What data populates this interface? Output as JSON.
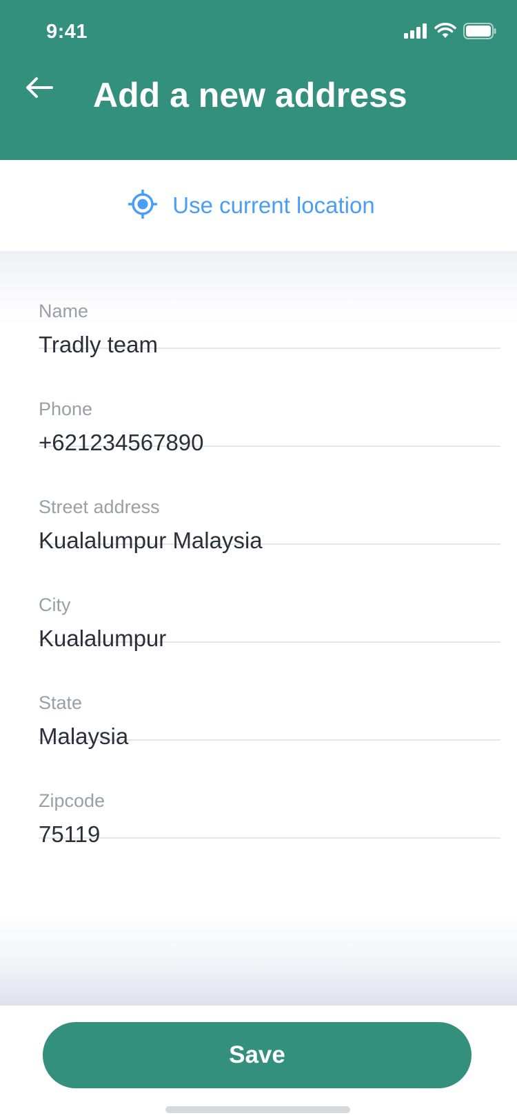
{
  "status_bar": {
    "time": "9:41",
    "icons": [
      "cellular-signal-icon",
      "wifi-icon",
      "battery-icon"
    ]
  },
  "header": {
    "title": "Add a new address",
    "back_icon": "arrow-left-icon"
  },
  "location": {
    "label": "Use current location",
    "icon": "crosshair-location-icon"
  },
  "form": {
    "fields": [
      {
        "label": "Name",
        "value": "Tradly team"
      },
      {
        "label": "Phone",
        "value": "+621234567890"
      },
      {
        "label": "Street address",
        "value": "Kualalumpur Malaysia"
      },
      {
        "label": "City",
        "value": "Kualalumpur"
      },
      {
        "label": "State",
        "value": "Malaysia"
      },
      {
        "label": "Zipcode",
        "value": "75119"
      }
    ]
  },
  "actions": {
    "save_label": "Save"
  },
  "colors": {
    "primary": "#33907c",
    "link": "#4a9df6",
    "label": "#9a9ea6",
    "text": "#2b2f3a"
  }
}
